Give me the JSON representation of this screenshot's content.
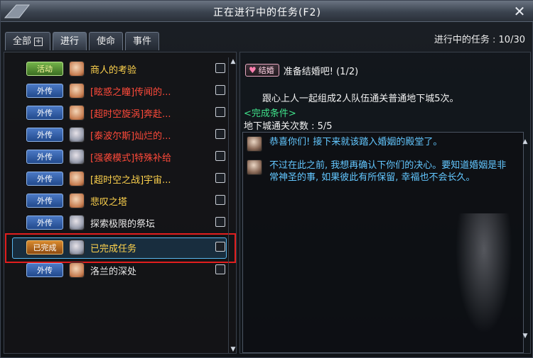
{
  "window": {
    "title": "正在进行中的任务(F2)"
  },
  "tabs": [
    {
      "label": "全部",
      "active": false
    },
    {
      "label": "进行",
      "active": true
    },
    {
      "label": "使命",
      "active": false
    },
    {
      "label": "事件",
      "active": false
    }
  ],
  "progress": {
    "label": "进行中的任务",
    "value": "10/30"
  },
  "quests": [
    {
      "badge": "活动",
      "badge_type": "event",
      "name": "商人的考验",
      "color": "gold",
      "avatar": "light"
    },
    {
      "badge": "外传",
      "badge_type": "side",
      "name": "[眩惑之瞳]传闻的...",
      "color": "red",
      "avatar": "light"
    },
    {
      "badge": "外传",
      "badge_type": "side",
      "name": "[超时空旋涡]奔赴...",
      "color": "red",
      "avatar": "light"
    },
    {
      "badge": "外传",
      "badge_type": "side",
      "name": "[泰波尔斯]灿烂的...",
      "color": "red",
      "avatar": "dark"
    },
    {
      "badge": "外传",
      "badge_type": "side",
      "name": "[强袭模式]特殊补给",
      "color": "red",
      "avatar": "dark"
    },
    {
      "badge": "外传",
      "badge_type": "side",
      "name": "[超时空之战]宇宙...",
      "color": "gold",
      "avatar": "light"
    },
    {
      "badge": "外传",
      "badge_type": "side",
      "name": "悲叹之塔",
      "color": "gold",
      "avatar": "light"
    },
    {
      "badge": "外传",
      "badge_type": "side",
      "name": "探索极限的祭坛",
      "color": "white",
      "avatar": "dark"
    },
    {
      "badge": "已完成",
      "badge_type": "done",
      "name": "已完成任务",
      "color": "gold",
      "avatar": "dark",
      "selected": true
    },
    {
      "badge": "外传",
      "badge_type": "side",
      "name": "洛兰的深处",
      "color": "white",
      "avatar": "light"
    }
  ],
  "detail": {
    "badge": "结婚",
    "title": "准备结婚吧! (1/2)",
    "description": "跟心上人一起组成2人队伍通关普通地下城5次。",
    "condition_label": "<完成条件>",
    "condition_value": "地下城通关次数 : 5/5",
    "dialog": [
      "恭喜你们! 接下来就该踏入婚姻的殿堂了。",
      "不过在此之前, 我想再确认下你们的决心。要知道婚姻是非常神圣的事, 如果彼此有所保留, 幸福也不会长久。"
    ]
  }
}
